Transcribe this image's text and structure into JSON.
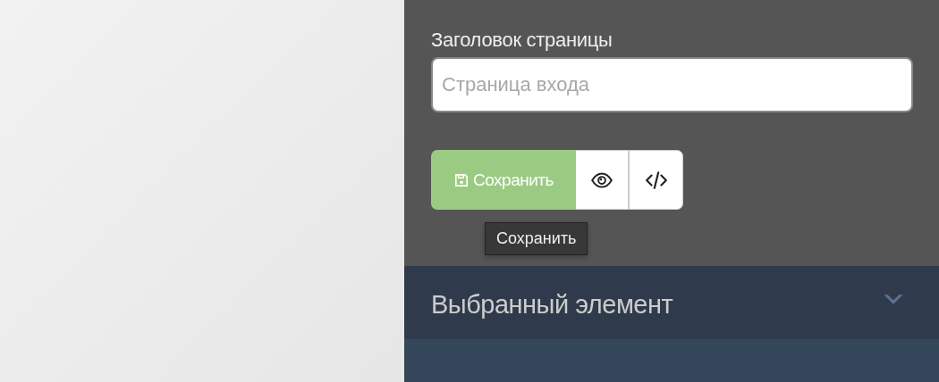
{
  "page_title_field": {
    "label": "Заголовок страницы",
    "placeholder": "Страница входа"
  },
  "toolbar": [
    {
      "kind": "save",
      "label": "Сохранить"
    },
    {
      "kind": "preview"
    },
    {
      "kind": "code"
    }
  ],
  "tooltip": "Сохранить",
  "section": {
    "title": "Выбранный элемент",
    "expanded": false
  }
}
